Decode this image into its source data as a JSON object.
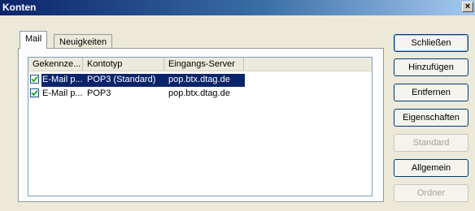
{
  "window": {
    "title": "Konten",
    "close_glyph": "×"
  },
  "tabs": [
    {
      "label": "Mail",
      "active": true
    },
    {
      "label": "Neuigkeiten",
      "active": false
    }
  ],
  "list": {
    "columns": [
      "Gekennze...",
      "Kontotyp",
      "Eingangs-Server",
      ""
    ],
    "rows": [
      {
        "name": "E-Mail p...",
        "type": "POP3 (Standard)",
        "server": "pop.btx.dtag.de",
        "checked": true,
        "selected": true
      },
      {
        "name": "E-Mail p...",
        "type": "POP3",
        "server": "pop.btx.dtag.de",
        "checked": true,
        "selected": false
      }
    ]
  },
  "buttons": [
    {
      "label": "Schließen",
      "enabled": true
    },
    {
      "label": "Hinzufügen",
      "enabled": true
    },
    {
      "label": "Entfernen",
      "enabled": true
    },
    {
      "label": "Eigenschaften",
      "enabled": true
    },
    {
      "label": "Standard",
      "enabled": false
    },
    {
      "label": "Allgemein",
      "enabled": true
    },
    {
      "label": "Ordner",
      "enabled": false
    }
  ],
  "colors": {
    "selection": "#0a246a",
    "title_bar": "#0a246a",
    "disabled_text": "#a1a192"
  }
}
